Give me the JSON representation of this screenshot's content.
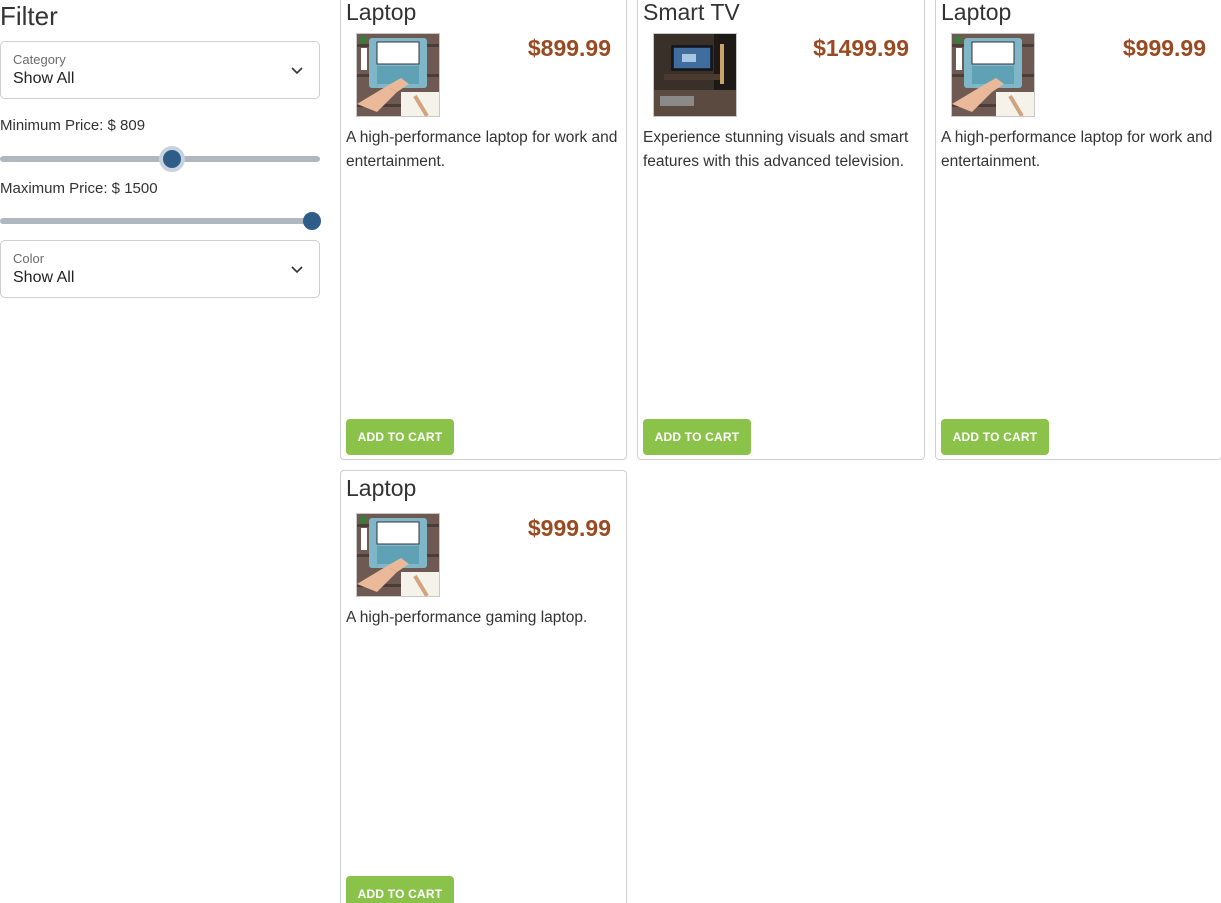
{
  "filter": {
    "title": "Filter",
    "category": {
      "label": "Category",
      "value": "Show All"
    },
    "min_price": {
      "label": "Minimum Price: $ 809",
      "value": 809
    },
    "max_price": {
      "label": "Maximum Price: $ 1500",
      "value": 1500
    },
    "color": {
      "label": "Color",
      "value": "Show All"
    },
    "chevron_icon": "chevron-down-icon"
  },
  "products": [
    {
      "title": "Laptop",
      "price": "$899.99",
      "description": "A high-performance laptop for work and entertainment.",
      "button": "ADD TO CART",
      "image_icon": "laptop-image"
    },
    {
      "title": "Smart TV",
      "price": "$1499.99",
      "description": "Experience stunning visuals and smart features with this advanced television.",
      "button": "ADD TO CART",
      "image_icon": "tv-image"
    },
    {
      "title": "Laptop",
      "price": "$999.99",
      "description": "A high-performance laptop for work and entertainment.",
      "button": "ADD TO CART",
      "image_icon": "laptop-image"
    },
    {
      "title": "Laptop",
      "price": "$999.99",
      "description": "A high-performance gaming laptop.",
      "button": "ADD TO CART",
      "image_icon": "laptop-image"
    }
  ],
  "colors": {
    "price": "#9a4a20",
    "button": "#8bc34a",
    "slider_thumb": "#2f5d8a",
    "slider_track": "#b0b8bf"
  }
}
